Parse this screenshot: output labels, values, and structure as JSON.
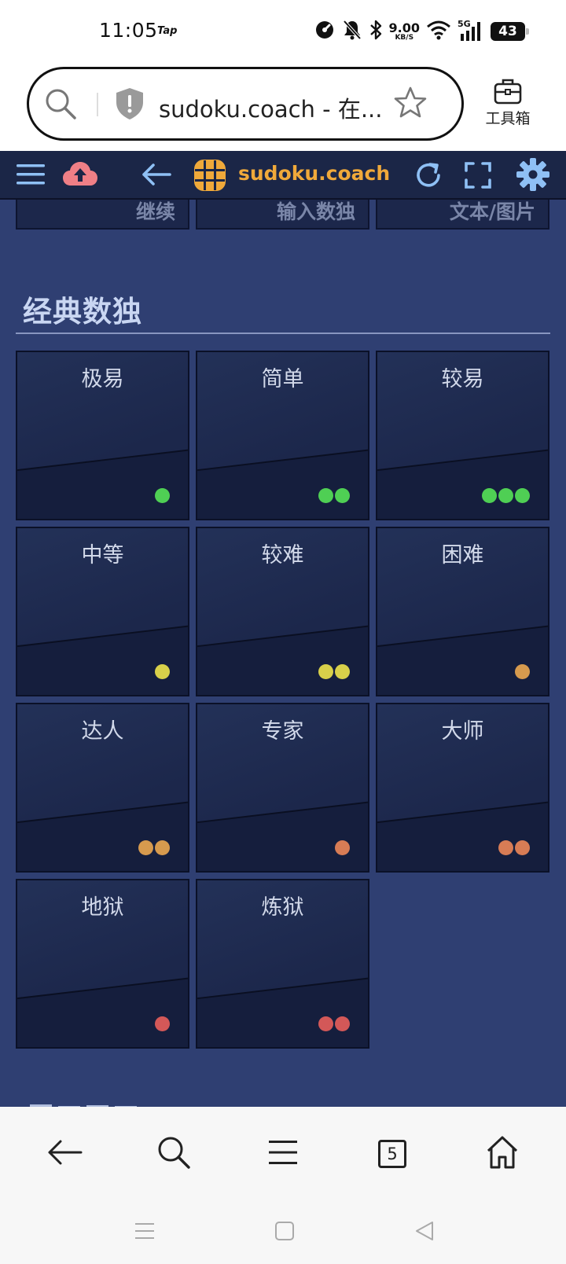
{
  "status_bar": {
    "time": "11:05",
    "app_tag": "Tap",
    "net_speed_value": "9.00",
    "net_speed_unit": "KB/S",
    "network_type": "5G",
    "battery": "43"
  },
  "browser": {
    "url_text": "sudoku.coach - 在...",
    "toolbox_label": "工具箱",
    "tab_count": "5"
  },
  "app_nav": {
    "brand": "sudoku.coach"
  },
  "prev_buttons": [
    "继续",
    "输入数独",
    "文本/图片"
  ],
  "section": {
    "title": "经典数独"
  },
  "levels": [
    {
      "label": "极易",
      "dots": 1,
      "color": "#4fcf54"
    },
    {
      "label": "简单",
      "dots": 2,
      "color": "#4fcf54"
    },
    {
      "label": "较易",
      "dots": 3,
      "color": "#4fcf54"
    },
    {
      "label": "中等",
      "dots": 1,
      "color": "#d8d04a"
    },
    {
      "label": "较难",
      "dots": 2,
      "color": "#d8d04a"
    },
    {
      "label": "困难",
      "dots": 1,
      "color": "#d69a4e"
    },
    {
      "label": "达人",
      "dots": 2,
      "color": "#d69a4e"
    },
    {
      "label": "专家",
      "dots": 1,
      "color": "#d77c55"
    },
    {
      "label": "大师",
      "dots": 2,
      "color": "#d77c55"
    },
    {
      "label": "地狱",
      "dots": 1,
      "color": "#d35858"
    },
    {
      "label": "炼狱",
      "dots": 2,
      "color": "#d35858"
    }
  ],
  "colors": {
    "nav_bg": "#1b2647",
    "content_bg": "#2f3f72",
    "brand": "#f0a93a",
    "nav_icon": "#8fc0f5",
    "upload_icon": "#ef7f86"
  },
  "icons": {
    "search": "search-icon",
    "shield": "shield-icon",
    "star": "star-icon",
    "toolbox": "toolbox-icon",
    "menu": "menu-icon",
    "upload": "cloud-upload-icon",
    "back": "arrow-left-icon",
    "logo": "sudoku-logo-icon",
    "refresh": "refresh-icon",
    "fullscreen": "fullscreen-icon",
    "settings": "gear-icon"
  }
}
